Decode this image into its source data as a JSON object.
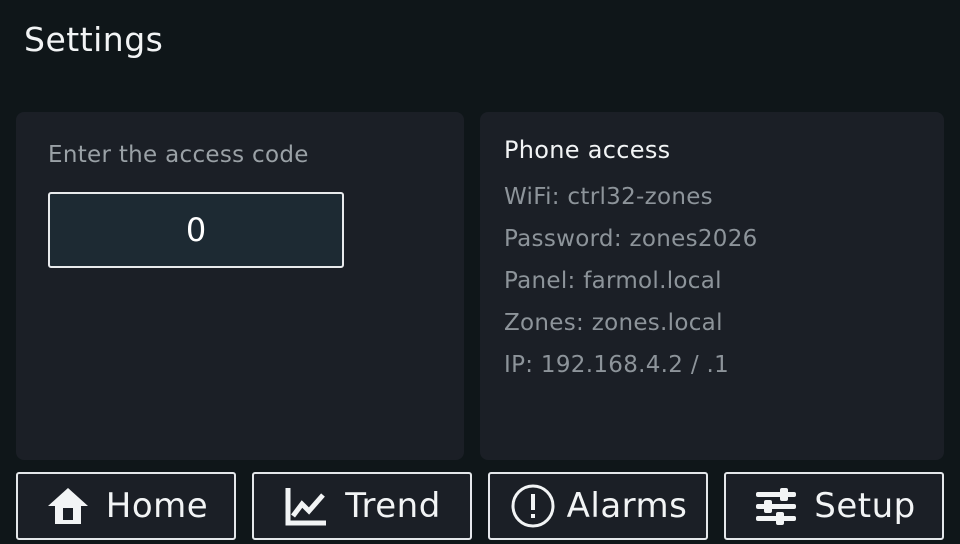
{
  "header": {
    "title": "Settings"
  },
  "access": {
    "label": "Enter the access code",
    "value": "0"
  },
  "phone": {
    "title": "Phone access",
    "lines": [
      "WiFi: ctrl32-zones",
      "Password: zones2026",
      "Panel: farmol.local",
      "Zones: zones.local",
      "IP: 192.168.4.2 / .1"
    ]
  },
  "nav": [
    {
      "label": "Home",
      "icon": "home-icon"
    },
    {
      "label": "Trend",
      "icon": "trend-icon"
    },
    {
      "label": "Alarms",
      "icon": "alert-icon"
    },
    {
      "label": "Setup",
      "icon": "sliders-icon"
    }
  ],
  "colors": {
    "background": "#0f1619",
    "panel": "#1b1f26",
    "input_bg": "#1d2a33",
    "text_primary": "#f2f4f5",
    "text_secondary": "#8d949a",
    "border": "#e4e7ea"
  }
}
